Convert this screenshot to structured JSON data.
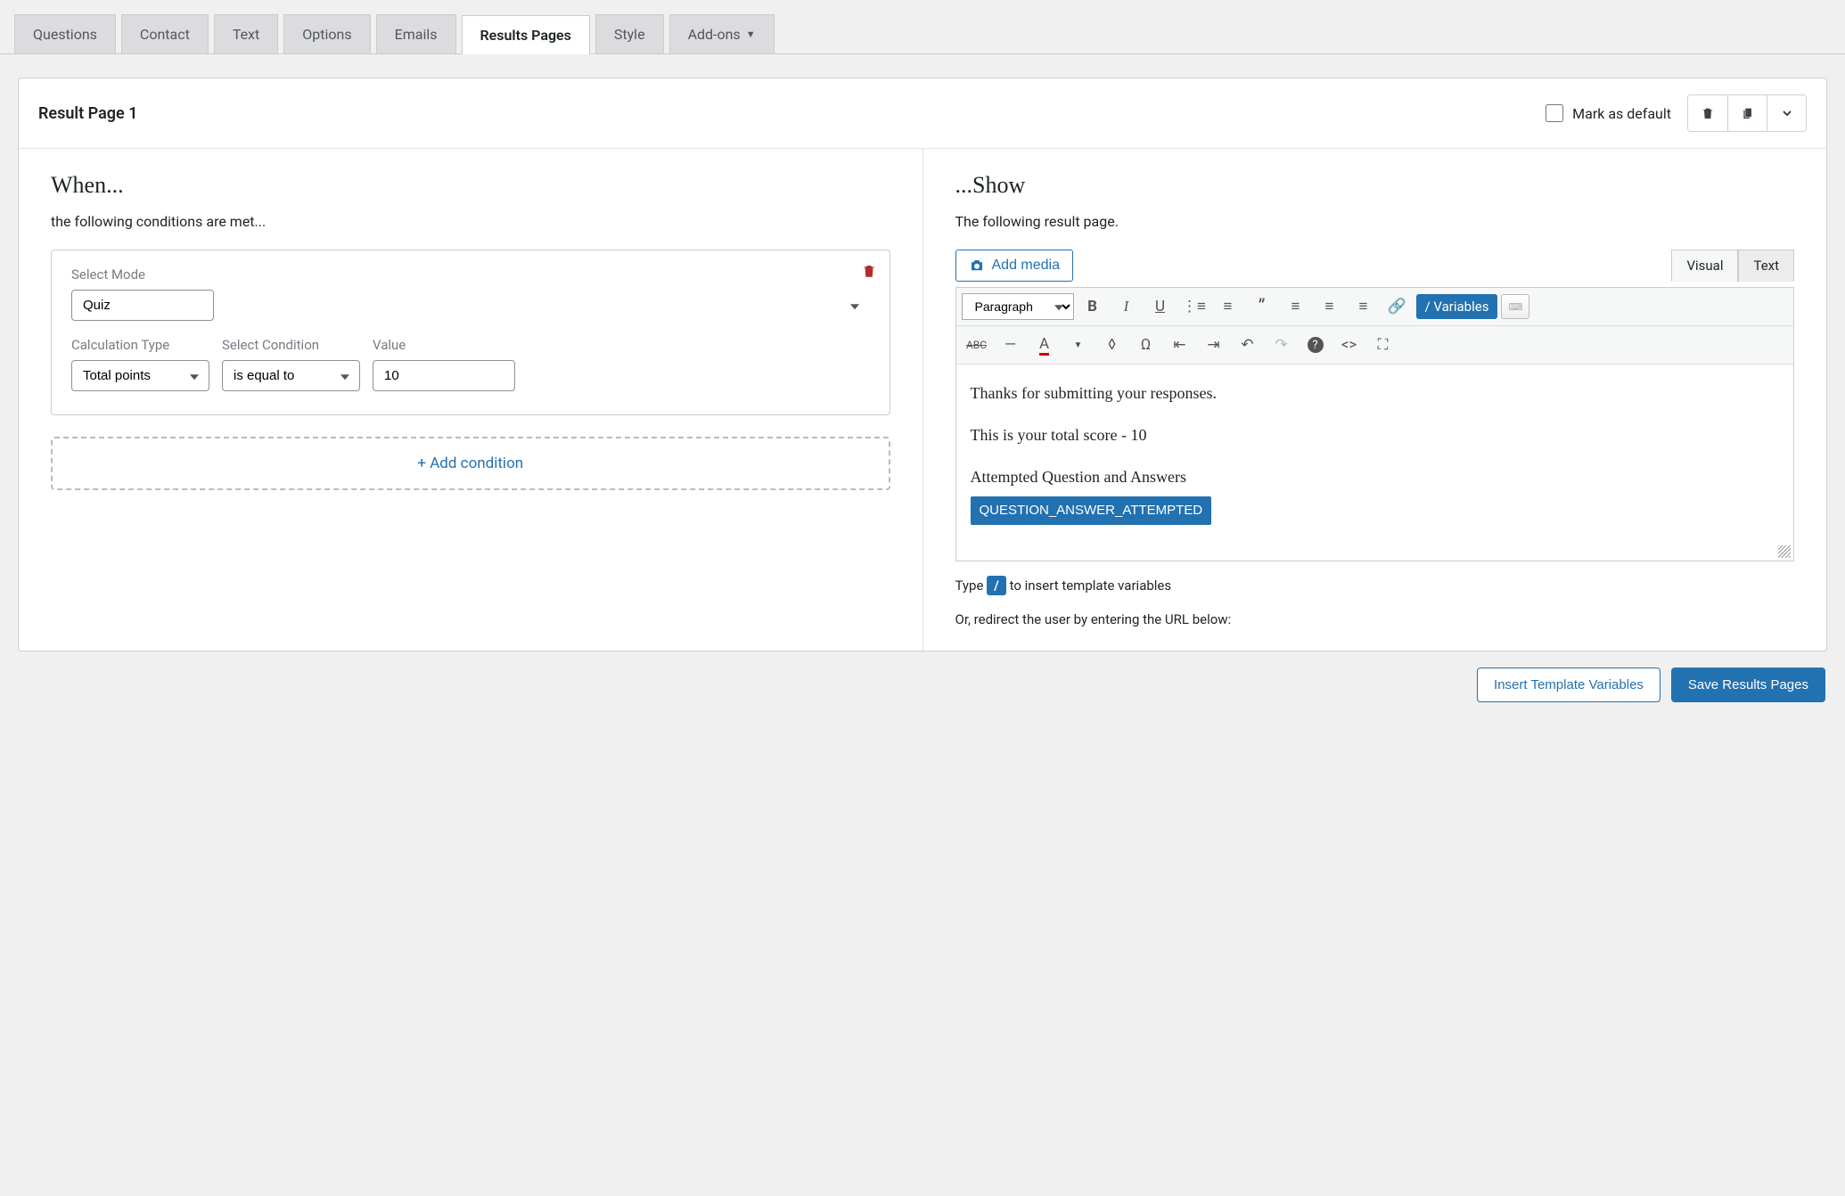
{
  "tabs": {
    "questions": "Questions",
    "contact": "Contact",
    "text": "Text",
    "options": "Options",
    "emails": "Emails",
    "results_pages": "Results Pages",
    "style": "Style",
    "addons": "Add-ons"
  },
  "panel": {
    "title": "Result Page 1",
    "mark_default_label": "Mark as default"
  },
  "when": {
    "title": "When...",
    "subtitle": "the following conditions are met...",
    "select_mode_label": "Select Mode",
    "select_mode_value": "Quiz",
    "calc_type_label": "Calculation Type",
    "calc_type_value": "Total points",
    "condition_label": "Select Condition",
    "condition_value": "is equal to",
    "value_label": "Value",
    "value_value": "10",
    "add_condition": "+ Add condition"
  },
  "show": {
    "title": "...Show",
    "subtitle": "The following result page.",
    "add_media": "Add media",
    "tab_visual": "Visual",
    "tab_text": "Text",
    "paragraph": "Paragraph",
    "variables_btn": "/ Variables",
    "content_line1": "Thanks for submitting your responses.",
    "content_line2": "This is your total score - 10",
    "content_line3": "Attempted Question and Answers",
    "var_pill": "QUESTION_ANSWER_ATTEMPTED",
    "hint_prefix": "Type ",
    "hint_slash": "/",
    "hint_suffix": " to insert template variables",
    "hint2": "Or, redirect the user by entering the URL below:"
  },
  "footer": {
    "insert_vars": "Insert Template Variables",
    "save": "Save Results Pages"
  }
}
